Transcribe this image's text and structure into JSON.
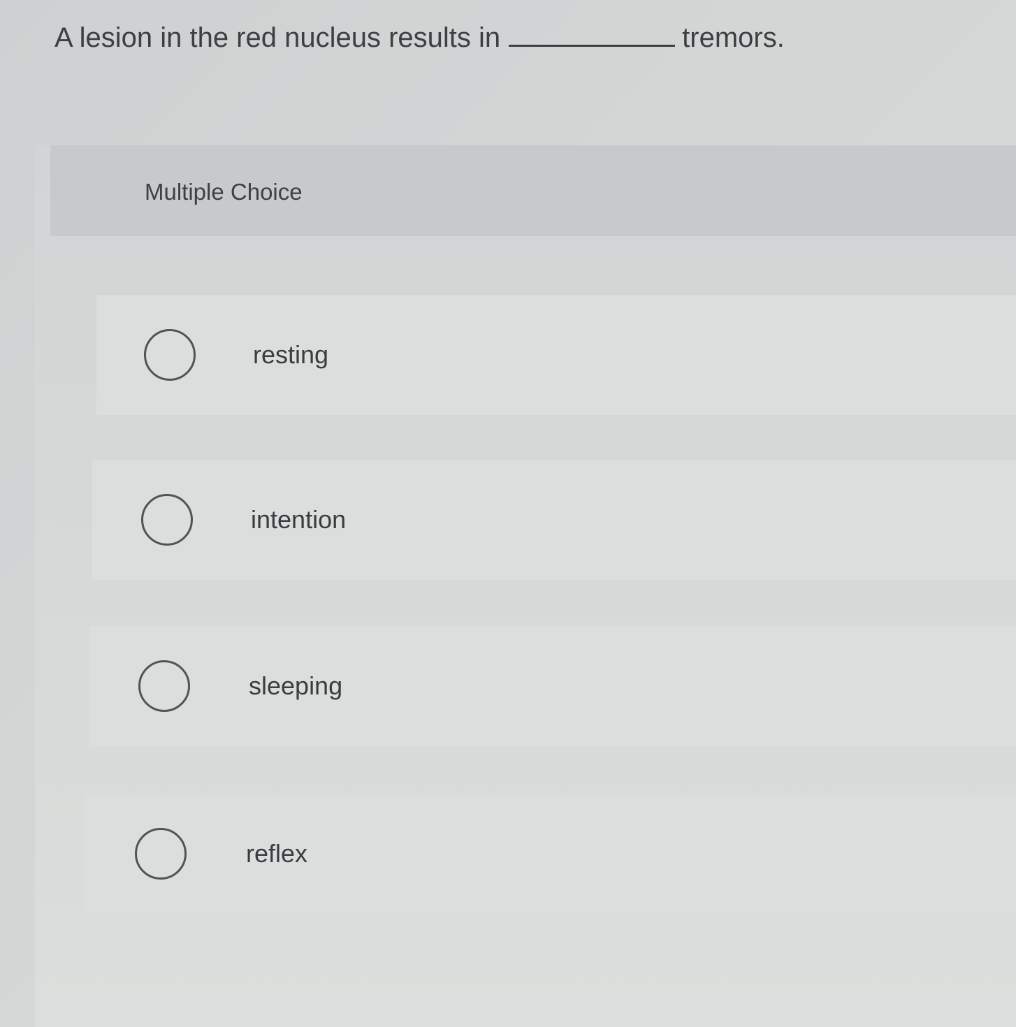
{
  "question": {
    "text_before": "A lesion in the red nucleus results in",
    "text_after": "tremors."
  },
  "multiple_choice": {
    "label": "Multiple Choice",
    "options": [
      {
        "label": "resting",
        "selected": false
      },
      {
        "label": "intention",
        "selected": false
      },
      {
        "label": "sleeping",
        "selected": false
      },
      {
        "label": "reflex",
        "selected": false
      }
    ]
  },
  "colors": {
    "background": "#d3d6d5",
    "header": "#c6caca",
    "option_background": "#dcdedd",
    "text": "#3d4043",
    "radio_border": "#505456"
  }
}
